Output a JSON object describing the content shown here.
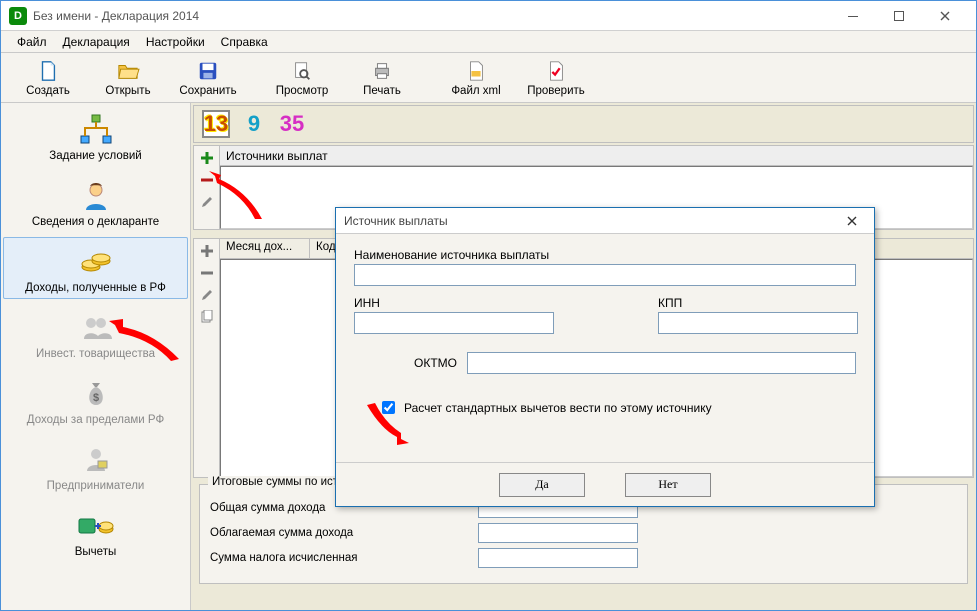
{
  "window": {
    "title": "Без имени - Декларация 2014",
    "logo": "D"
  },
  "menu": {
    "file": "Файл",
    "decl": "Декларация",
    "settings": "Настройки",
    "help": "Справка"
  },
  "toolbar": {
    "create": "Создать",
    "open": "Откpыть",
    "save": "Сохранить",
    "preview": "Просмотр",
    "print": "Печать",
    "xml": "Файл xml",
    "check": "Проверить"
  },
  "sidebar": {
    "conditions": "Задание условий",
    "declarant": "Сведения о декларанте",
    "income_rf": "Доходы, полученные в РФ",
    "invest": "Инвест. товарищества",
    "income_abroad": "Доходы за пределами РФ",
    "entrepreneurs": "Предприниматели",
    "deductions": "Вычеты"
  },
  "rates": {
    "r13": "13",
    "r9": "9",
    "r35": "35"
  },
  "sources": {
    "header": "Источники выплат"
  },
  "months": {
    "col_month": "Месяц дох...",
    "col_code": "Код..."
  },
  "totals": {
    "legend": "Итоговые суммы по источнику выплат",
    "total_income": "Общая сумма дохода",
    "taxable_income": "Облагаемая сумма дохода",
    "tax_calculated": "Сумма налога исчисленная"
  },
  "modal": {
    "title": "Источник выплаты",
    "name_label": "Наименование источника выплаты",
    "name_value": "",
    "inn_label": "ИНН",
    "inn_value": "",
    "kpp_label": "КПП",
    "kpp_value": "",
    "oktmo_label": "ОКТМО",
    "oktmo_value": "",
    "checkbox_label": "Расчет стандартных вычетов вести по этому источнику",
    "yes": "Да",
    "no": "Нет"
  }
}
